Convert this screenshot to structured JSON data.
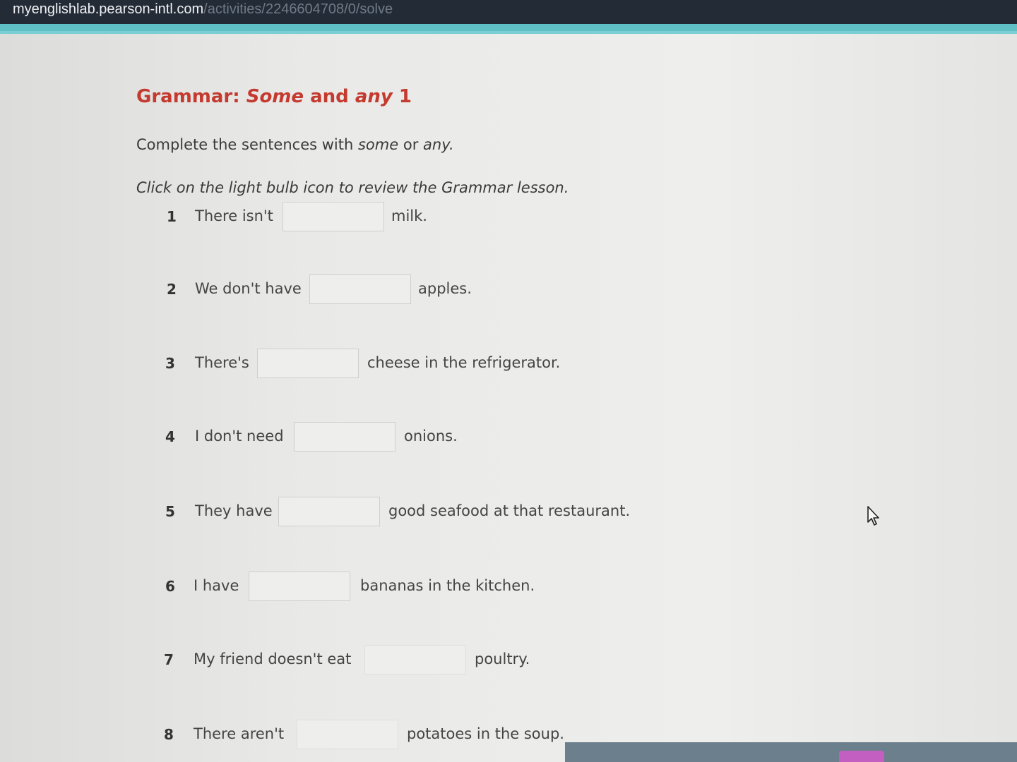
{
  "browser": {
    "url_domain": "myenglishlab.pearson-intl.com",
    "url_path": "/activities/2246604708/0/solve"
  },
  "activity": {
    "title_prefix": "Grammar:",
    "title_some": "Some",
    "title_and": "and",
    "title_any": "any",
    "title_number": "1",
    "instruction_text": "Complete the sentences with",
    "instruction_some": "some",
    "instruction_or": "or",
    "instruction_any": "any.",
    "hint": "Click on the light bulb icon to review the Grammar lesson."
  },
  "questions": [
    {
      "number": "1",
      "before": "There isn't",
      "answer": "",
      "after": "milk."
    },
    {
      "number": "2",
      "before": "We don't have",
      "answer": "",
      "after": "apples."
    },
    {
      "number": "3",
      "before": "There's",
      "answer": "",
      "after": "cheese in the refrigerator."
    },
    {
      "number": "4",
      "before": "I don't need",
      "answer": "",
      "after": "onions."
    },
    {
      "number": "5",
      "before": "They have",
      "answer": "",
      "after": "good seafood at that restaurant."
    },
    {
      "number": "6",
      "before": "I have",
      "answer": "",
      "after": "bananas in the kitchen."
    },
    {
      "number": "7",
      "before": "My friend doesn't eat",
      "answer": "",
      "after": "poultry."
    },
    {
      "number": "8",
      "before": "There aren't",
      "answer": "",
      "after": "potatoes in the soup."
    }
  ],
  "icons": {
    "cursor": "mouse-pointer-icon"
  },
  "colors": {
    "title": "#c43a2f",
    "accent": "#5fc0c6",
    "url_bar": "#232b36"
  }
}
